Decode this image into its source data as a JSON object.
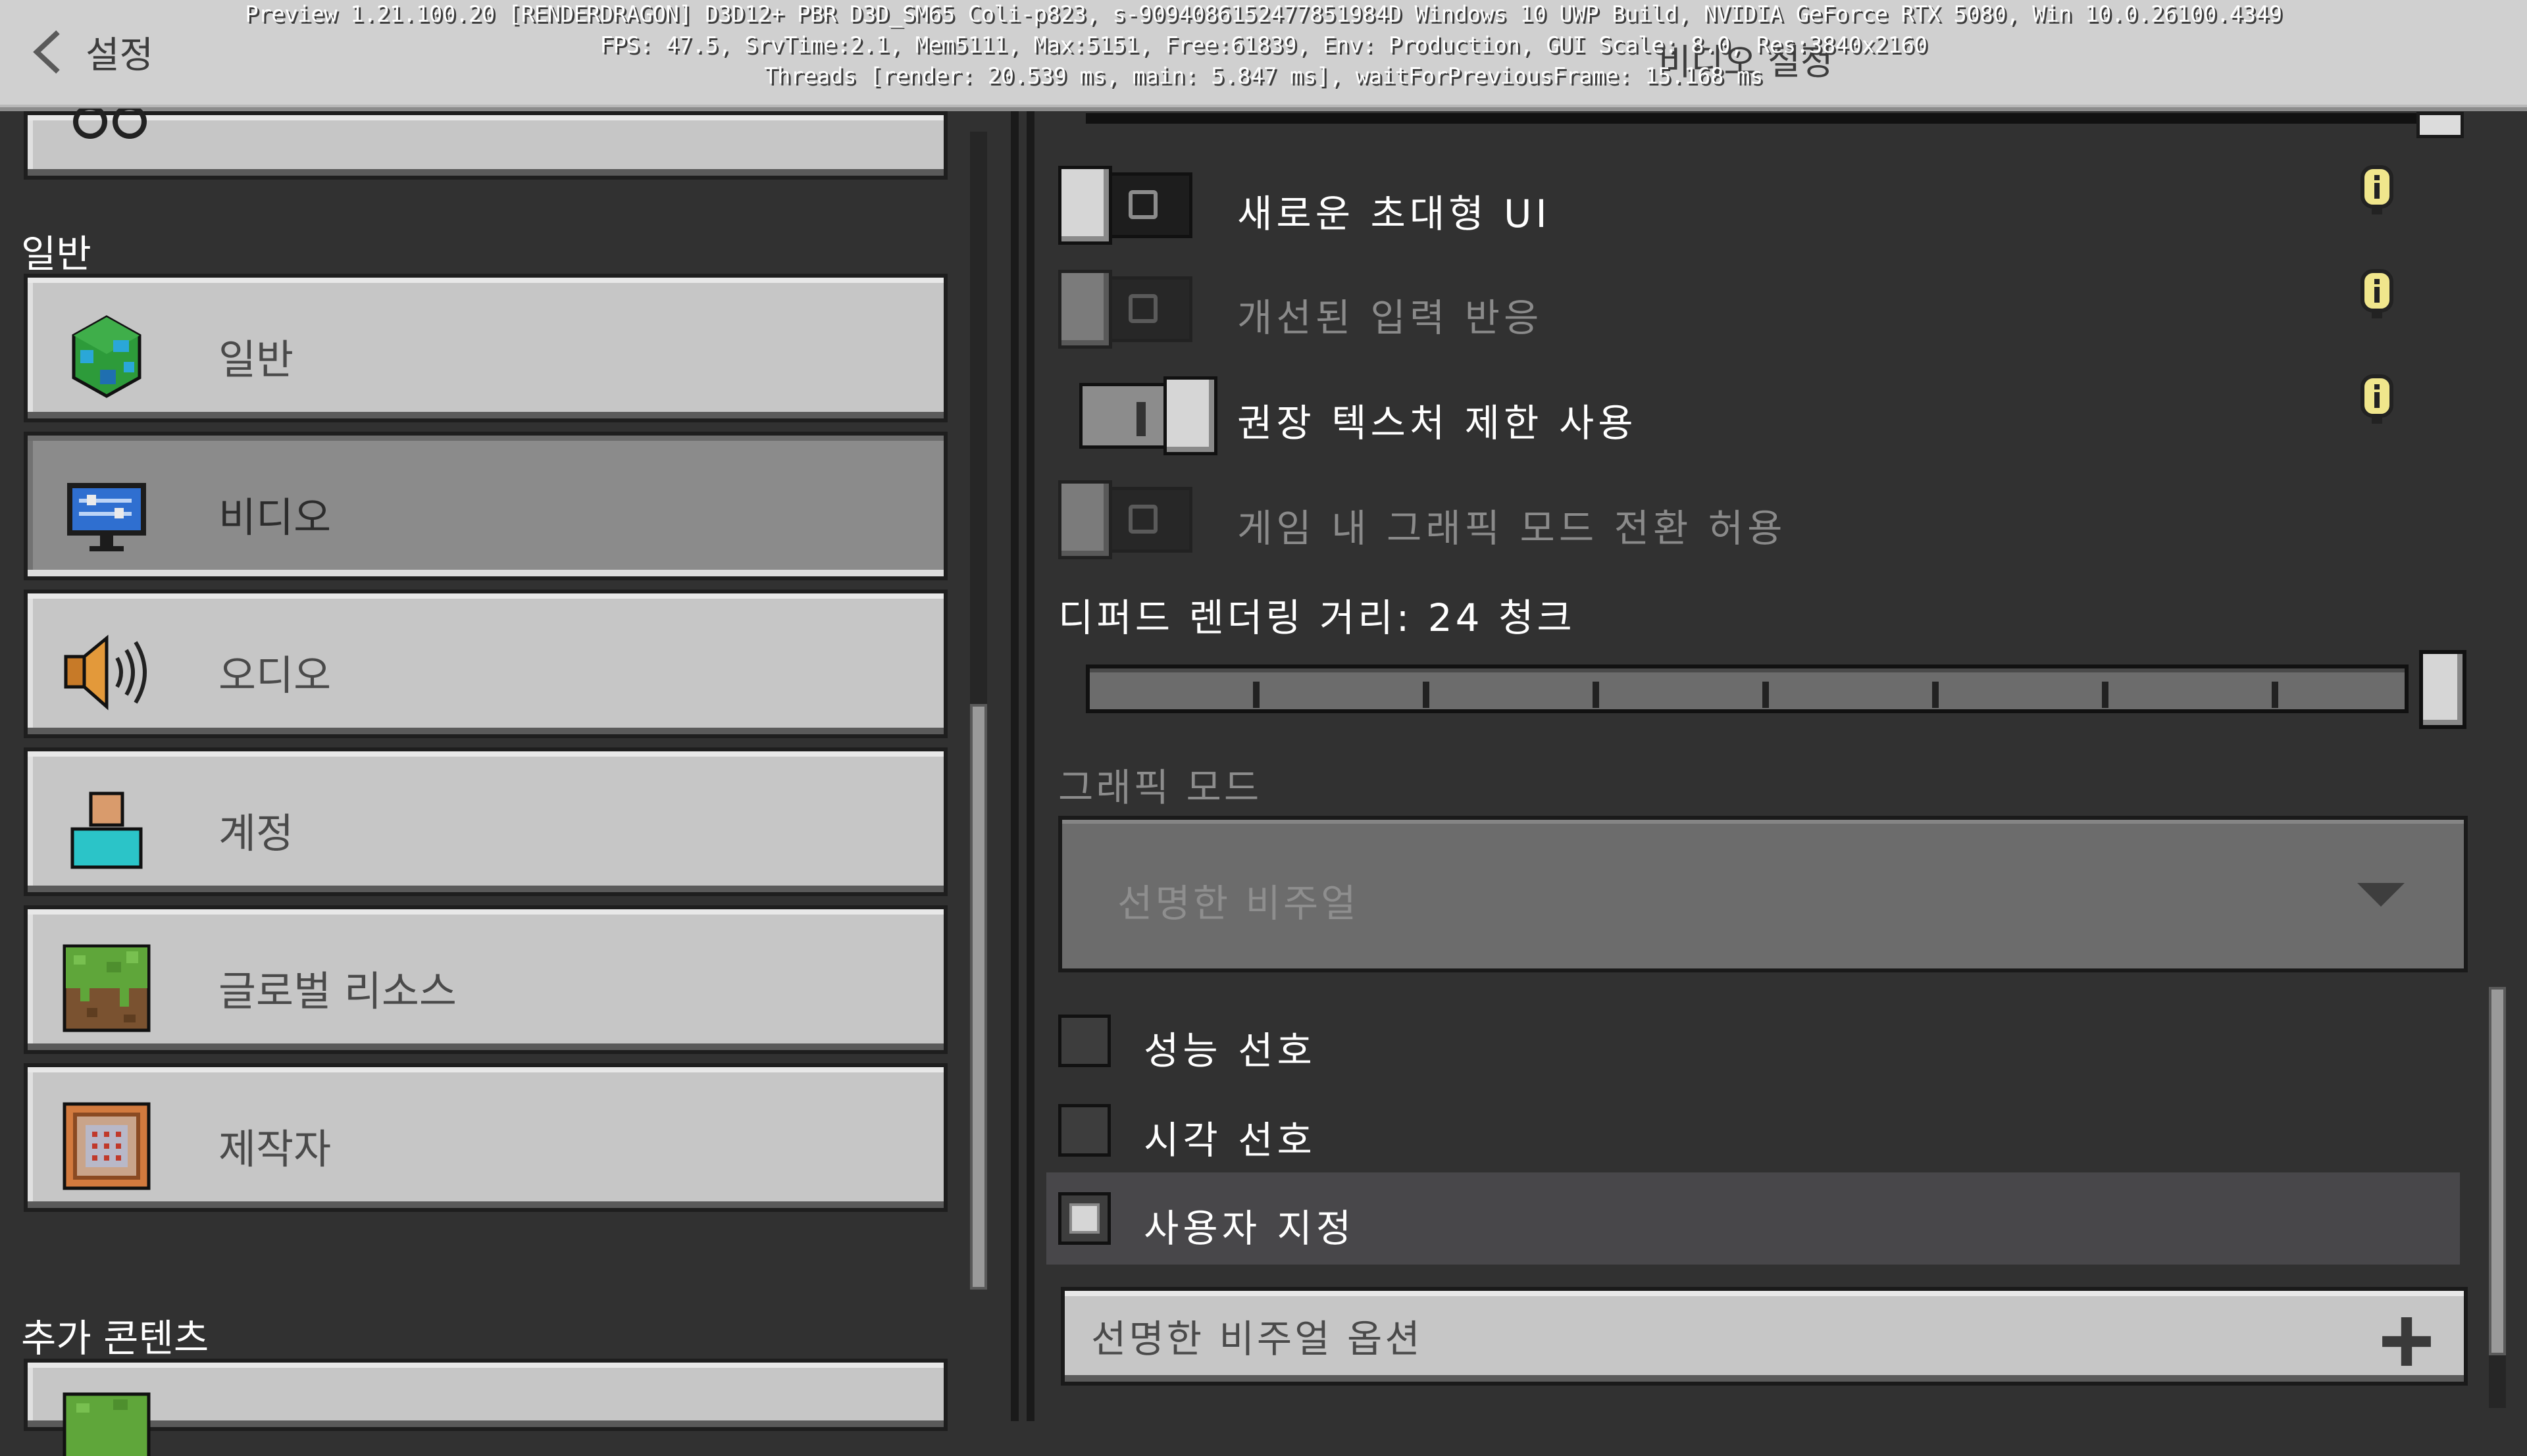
{
  "header": {
    "back_label": "설정",
    "title": "비디오 설정",
    "debug": [
      "Preview 1.21.100.20 [RENDERDRAGON] D3D12+ PBR D3D_SM65 Coli-p823, s-9094086152477851984D Windows 10 UWP Build, NVIDIA GeForce RTX 5080, Win 10.0.26100.4349",
      "FPS: 47.5, SrvTime:2.1, Mem5111, Max:5151, Free:61839, Env: Production, GUI Scale: 8.0, Res:3840x2160",
      "Threads [render: 20.539 ms, main: 5.847 ms], waitForPreviousFrame: 15.168 ms"
    ]
  },
  "sidebar": {
    "section_general": "일반",
    "section_additional": "추가 콘텐츠",
    "items": [
      {
        "label": "일반",
        "icon": "globe-icon"
      },
      {
        "label": "비디오",
        "icon": "monitor-icon",
        "active": true
      },
      {
        "label": "오디오",
        "icon": "speaker-icon"
      },
      {
        "label": "계정",
        "icon": "account-icon"
      },
      {
        "label": "글로벌 리소스",
        "icon": "grass-block-icon"
      },
      {
        "label": "제작자",
        "icon": "command-block-icon"
      }
    ]
  },
  "content": {
    "toggles": [
      {
        "label": "새로운 초대형 UI",
        "state": "off",
        "disabled": false,
        "info": true
      },
      {
        "label": "개선된 입력 반응",
        "state": "off",
        "disabled": true,
        "info": true
      },
      {
        "label": "권장 텍스처 제한 사용",
        "state": "on",
        "disabled": false,
        "info": true
      },
      {
        "label": "게임 내 그래픽 모드 전환 허용",
        "state": "off",
        "disabled": true,
        "info": false
      }
    ],
    "render_distance": {
      "label": "디퍼드 렌더링 거리: 24 청크",
      "value_fraction": 1.0,
      "ticks": 7
    },
    "graphics_mode": {
      "label": "그래픽 모드",
      "selected": "선명한 비주얼"
    },
    "radio_options": [
      {
        "label": "성능 선호",
        "selected": false
      },
      {
        "label": "시각 선호",
        "selected": false
      },
      {
        "label": "사용자 지정",
        "selected": true
      }
    ],
    "expander": {
      "label": "선명한 비주얼 옵션"
    }
  },
  "colors": {
    "background": "#313131",
    "button": "#c6c6c6",
    "button_active": "#8b8b8b",
    "header": "#d0d0d0",
    "info_icon": "#f0e68c"
  }
}
